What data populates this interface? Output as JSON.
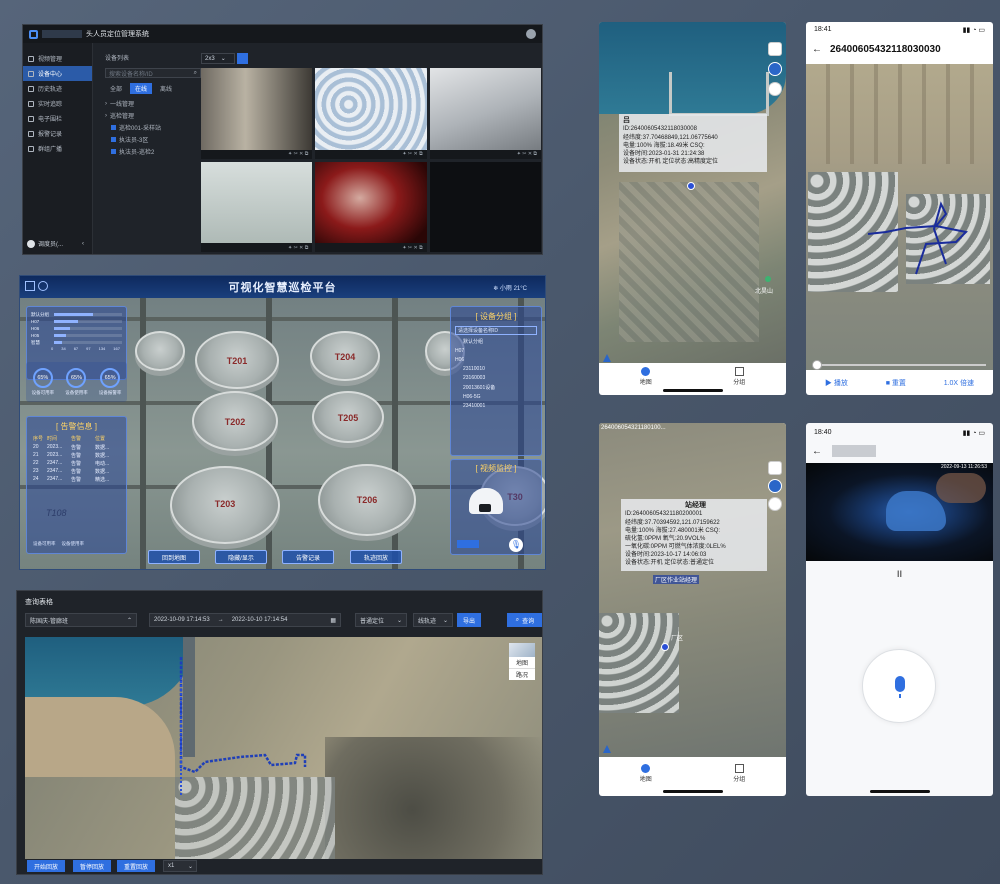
{
  "panel1": {
    "title": "头人员定位管理系统",
    "nav": [
      "视频管理",
      "设备中心",
      "历史轨迹",
      "实时追踪",
      "电子围栏",
      "报警记录",
      "群组广播"
    ],
    "nav_active": 1,
    "user_label": "调度员(...",
    "tree_header": "设备列表",
    "search_placeholder": "搜索设备名称/ID",
    "filter_tabs": [
      "全部",
      "在线",
      "离线"
    ],
    "tree_items": [
      "一线管理",
      "巡检管理",
      "巡检001-采样站",
      "执法员-3区",
      "执法员-巡检2"
    ],
    "layout_select": "2x3",
    "cell_controls": "✦ ✂ ✕ ⧉"
  },
  "panel2": {
    "title": "可视化智慧巡检平台",
    "weather": "小雨 21°C",
    "bar_rows": [
      {
        "label": "默认分组",
        "value": 95
      },
      {
        "label": "H07",
        "value": 60
      },
      {
        "label": "H06",
        "value": 40
      },
      {
        "label": "H05",
        "value": 30
      },
      {
        "label": "智慧",
        "value": 20
      }
    ],
    "bar_ticks": [
      "0",
      "34",
      "67",
      "97",
      "134",
      "167"
    ],
    "gauges": [
      {
        "value": "65%",
        "label": "设备可用率"
      },
      {
        "value": "65%",
        "label": "设备使用率"
      },
      {
        "value": "65%",
        "label": "设备报警率"
      }
    ],
    "alarm_title": "[ 告警信息 ]",
    "alarm_headers": [
      "序号",
      "时间",
      "告警",
      "位置"
    ],
    "alarm_rows": [
      [
        "20",
        "2023...",
        "告警",
        "数据..."
      ],
      [
        "21",
        "2023...",
        "告警",
        "数据..."
      ],
      [
        "22",
        "2347...",
        "告警",
        "电动..."
      ],
      [
        "23",
        "2347...",
        "告警",
        "数据..."
      ],
      [
        "24",
        "2347...",
        "告警",
        "精选..."
      ]
    ],
    "alarm_legend": [
      "设备可用率",
      "设备使用率"
    ],
    "tanks": [
      "T201",
      "T204",
      "T202",
      "T205",
      "T203",
      "T206",
      "T30"
    ],
    "bottom_buttons": [
      "回到地图",
      "隐藏/显示",
      "告警记录",
      "轨迹回放"
    ],
    "group_title": "[ 设备分组 ]",
    "group_search": "请选择设备名称ID",
    "group_items": [
      "默认分组",
      "H07",
      "H06",
      "23110010",
      "23160003",
      "20013601设备",
      "H06-5G",
      "23410001"
    ],
    "video_title": "[ 视频监控 ]",
    "video_code": "T108"
  },
  "panel3": {
    "title": "查询表格",
    "person_select": "陈国庆-管廊班",
    "start_time": "2022-10-09 17:14:53",
    "range_sep": "→",
    "end_time": "2022-10-10 17:14:54",
    "mode_select": "普通定位",
    "line_select": "线轨迹",
    "export_btn": "导出",
    "query_btn": "查询",
    "map_toggle": [
      "地图",
      "路况"
    ],
    "playback_buttons": [
      "开始回放",
      "暂停回放",
      "重置回放"
    ],
    "speed_select": "x1"
  },
  "phone1": {
    "info_lines": [
      "吕",
      "ID:264006054321​18030008",
      "经纬度:37.70468849,121.06775640",
      "电量:100% 海拔:18.49米 CSQ:",
      "设备时间:2023-01-31 21:24:38",
      "设备状态:开机 定位状态:高精度定位"
    ],
    "place_label": "北昊山",
    "tabs": [
      "地图",
      "分组"
    ]
  },
  "phone2": {
    "status_time": "18:41",
    "title": "2640060543​2118030030",
    "play": "播放",
    "reset": "重置",
    "speed": "1.0X 倍速"
  },
  "phone3": {
    "top_label": "264006054321180100...",
    "info_lines": [
      "站经理",
      "ID:264006054321180200001",
      "经纬度:37.70394592,121.07159622",
      "电量:100% 海拔:27.480001米 CSQ:",
      "硫化氢:0PPM 氧气:20.9VOL%",
      "一氧化碳:0PPM 可燃气体浓度:0LEL%",
      "设备时间:2023-10-17 14:06:03",
      "设备状态:开机 定位状态:普通定位"
    ],
    "map_label": "厂区作业站经理",
    "small_label": "厂区",
    "tabs": [
      "地图",
      "分组"
    ]
  },
  "phone4": {
    "status_time": "18:40",
    "video_timestamp": "2022-09-13 11:26:53",
    "pause": "II"
  },
  "colors": {
    "accent": "#2f6fe0",
    "track": "#1f3fb8"
  }
}
